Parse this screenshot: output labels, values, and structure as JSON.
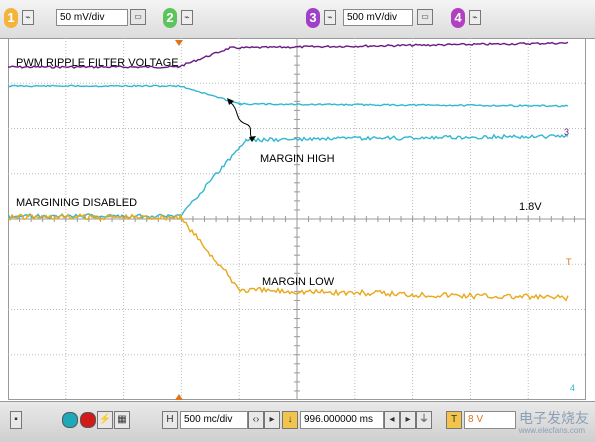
{
  "toolbar": {
    "channels": [
      {
        "number": "1",
        "scale": "50 mV/div",
        "color": "#f3b43c"
      },
      {
        "number": "2",
        "scale": "",
        "color": "#5cc45c"
      },
      {
        "number": "3",
        "scale": "500 mV/div",
        "color": "#a040c8"
      },
      {
        "number": "4",
        "scale": "",
        "color": "#b040c0"
      }
    ]
  },
  "screen": {
    "labels": {
      "pwm": "PWM RIPPLE FILTER VOLTAGE",
      "margin_high": "MARGIN HIGH",
      "margining_disabled": "MARGINING DISABLED",
      "voltage": "1.8V",
      "margin_low": "MARGIN LOW"
    },
    "markers": {
      "ch3_ref": "3",
      "trigger": "T",
      "ch4_ref": "4"
    },
    "colors": {
      "ch1": "#e8a818",
      "ch3": "#6a1a80",
      "ch4": "#31b8d0",
      "trigger": "#e0741a",
      "grid": "#b8b8b8"
    }
  },
  "bottombar": {
    "h_label": "H",
    "timebase": "500 mc/div",
    "position": "996.000000 ms",
    "trigger_label": "T",
    "trigger_level": "8 V",
    "watermark": "电子发烧友",
    "watermark_sub": "www.elecfans.com"
  }
}
